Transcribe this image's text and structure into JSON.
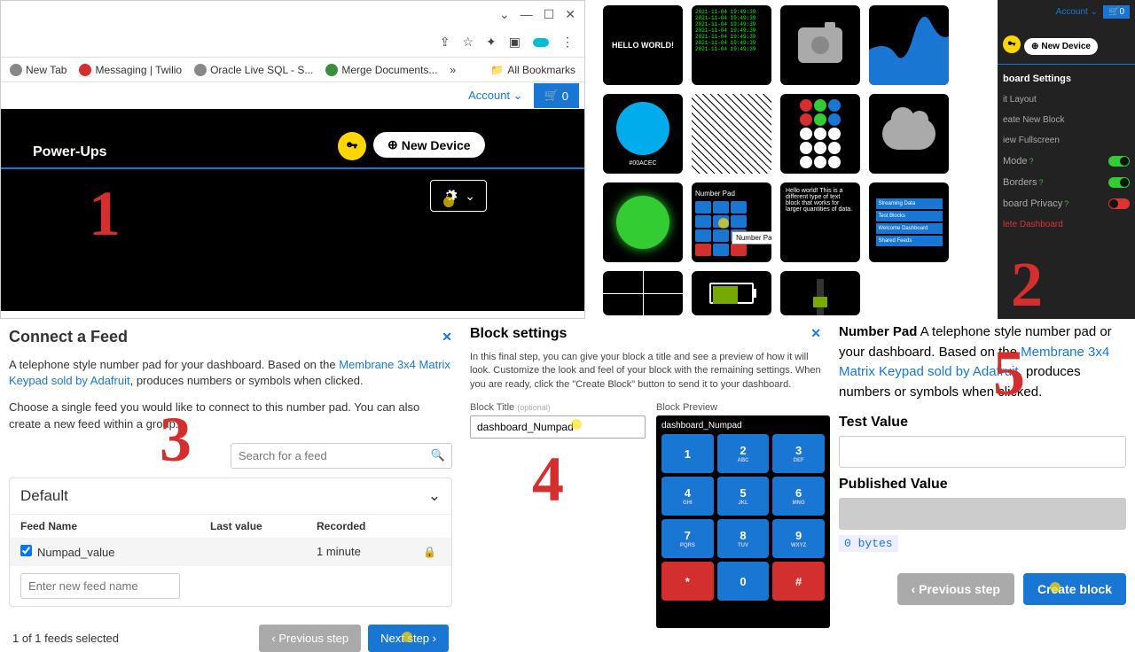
{
  "panel1": {
    "bookmarks": {
      "new_tab": "New Tab",
      "messaging": "Messaging | Twilio",
      "oracle": "Oracle Live SQL - S...",
      "merge": "Merge Documents...",
      "more": "»",
      "all": "All Bookmarks"
    },
    "account": "Account",
    "cart_count": "0",
    "dash_title": "Power-Ups",
    "new_device": "New Device"
  },
  "panel2": {
    "hello": "HELLO WORLD!",
    "terminal_lines": "2021-11-04 19:49:39\n2021-11-04 19:49:39\n2021-11-04 19:49:39\n2021-11-04 19:49:39\n2021-11-04 19:49:39\n2021-11-04 19:49:39\n2021-11-04 19:49:39",
    "hex": "#00ACEC",
    "numpad_label": "Number Pad",
    "numpad_tooltip": "Number Pad",
    "textblock": "Hello world! This is a different type of text block that works for larger quantities of data.",
    "btn1": "Streaming Data",
    "btn2": "Test Blocks",
    "btn3": "Welcome Dashboard",
    "btn4": "Shared Feeds",
    "sidebar": {
      "account": "Account",
      "cart": "0",
      "new_device": "New Device",
      "heading": "board Settings",
      "edit": "it Layout",
      "create": "eate New Block",
      "full": "iew Fullscreen",
      "mode": "Mode",
      "borders": "Borders",
      "privacy": "board Privacy",
      "delete": "lete Dashboard"
    }
  },
  "panel3": {
    "heading": "Connect a Feed",
    "desc1": "A telephone style number pad for your dashboard. Based on the ",
    "link": "Membrane 3x4 Matrix Keypad sold by Adafruit",
    "desc2": ", produces numbers or symbols when clicked.",
    "desc3": "Choose a single feed you would like to connect to this number pad. You can also create a new feed within a group.",
    "search_ph": "Search for a feed",
    "group": "Default",
    "col1": "Feed Name",
    "col2": "Last value",
    "col3": "Recorded",
    "row_name": "Numpad_value",
    "row_rec": "1 minute",
    "new_ph": "Enter new feed name",
    "count": "1 of 1 feeds selected",
    "prev": "Previous step",
    "next": "Next step"
  },
  "panel4": {
    "heading": "Block settings",
    "desc": "In this final step, you can give your block a title and see a preview of how it will look. Customize the look and feel of your block with the remaining settings. When you are ready, click the \"Create Block\" button to send it to your dashboard.",
    "title_label": "Block Title",
    "optional": "(optional)",
    "title_value": "dashboard_Numpad",
    "preview_label": "Block Preview",
    "preview_title": "dashboard_Numpad",
    "keys": [
      {
        "n": "1",
        "s": ""
      },
      {
        "n": "2",
        "s": "ABC"
      },
      {
        "n": "3",
        "s": "DEF"
      },
      {
        "n": "4",
        "s": "GHI"
      },
      {
        "n": "5",
        "s": "JKL"
      },
      {
        "n": "6",
        "s": "MNO"
      },
      {
        "n": "7",
        "s": "PQRS"
      },
      {
        "n": "8",
        "s": "TUV"
      },
      {
        "n": "9",
        "s": "WXYZ"
      },
      {
        "n": "*",
        "s": "",
        "red": true
      },
      {
        "n": "0",
        "s": ""
      },
      {
        "n": "#",
        "s": "",
        "red": true
      }
    ]
  },
  "panel5": {
    "heading_bold": "Number Pad",
    "desc1": " A telephone style number pad or your dashboard. Based on the ",
    "link": "Membrane 3x4 Matrix Keypad sold by Adafruit",
    "desc2": ", produces numbers or symbols when clicked.",
    "test": "Test Value",
    "pub": "Published Value",
    "bytes": "0 bytes",
    "prev": "Previous step",
    "create": "Create block"
  },
  "nums": {
    "n1": "1",
    "n2": "2",
    "n3": "3",
    "n4": "4",
    "n5": "5"
  }
}
